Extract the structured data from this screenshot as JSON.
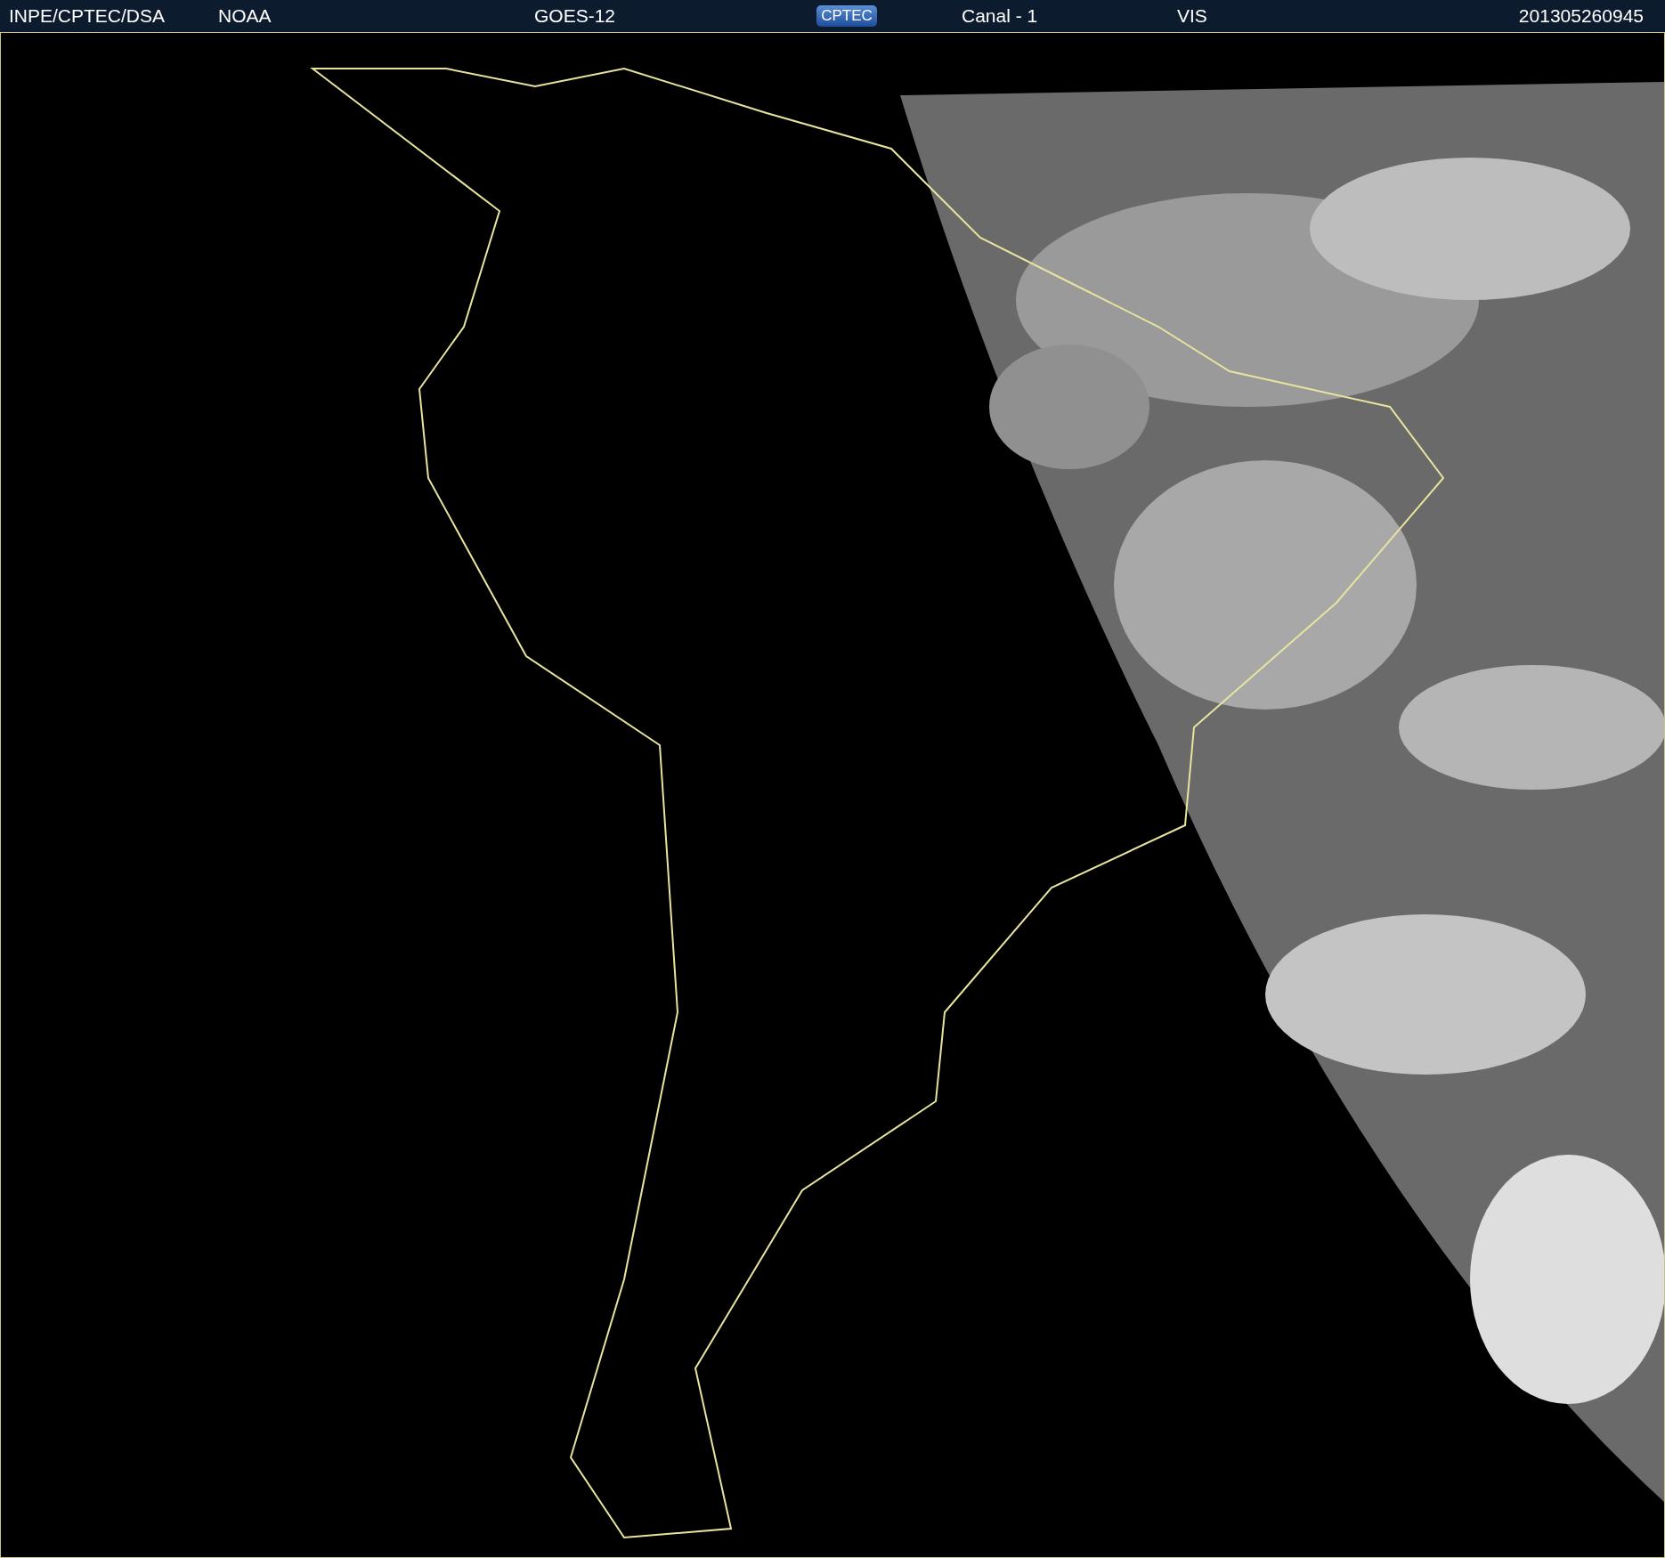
{
  "header": {
    "items": [
      {
        "kind": "text",
        "text": "INPE/CPTEC/DSA"
      },
      {
        "kind": "text",
        "text": "NOAA"
      },
      {
        "kind": "text",
        "text": "GOES-12"
      },
      {
        "kind": "logo",
        "text": "CPTEC"
      },
      {
        "kind": "text",
        "text": "Canal - 1"
      },
      {
        "kind": "text",
        "text": "VIS"
      },
      {
        "kind": "text",
        "text": "201305260945"
      }
    ]
  }
}
